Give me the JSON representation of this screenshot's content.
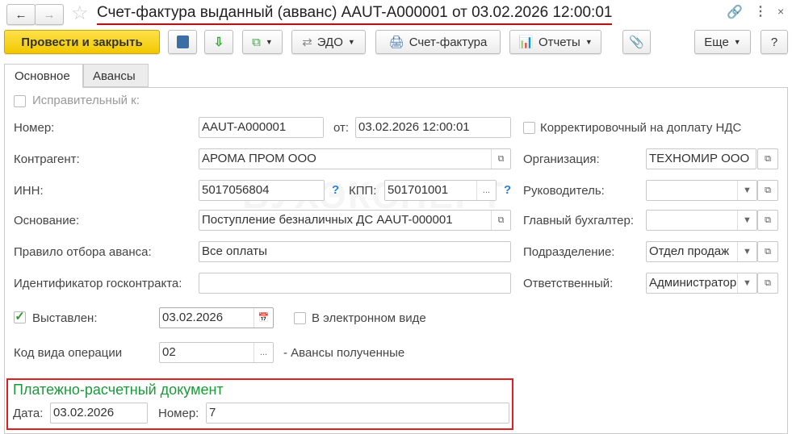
{
  "title": "Счет-фактура выданный (авванс) AAUT-A000001 от 03.02.2026 12:00:01",
  "toolbar": {
    "post_close": "Провести и закрыть",
    "edo": "ЭДО",
    "invoice": "Счет-фактура",
    "reports": "Отчеты",
    "more": "Еще",
    "help": "?"
  },
  "tabs": [
    {
      "label": "Основное"
    },
    {
      "label": "Авансы"
    }
  ],
  "form": {
    "corrective_label": "Исправительный к:",
    "number_label": "Номер:",
    "number": "AAUT-A000001",
    "from_label": "от:",
    "date": "03.02.2026 12:00:01",
    "correction_label": "Корректировочный на доплату НДС",
    "counterparty_label": "Контрагент:",
    "counterparty": "АРОМА ПРОМ ООО",
    "org_label": "Организация:",
    "org": "ТЕХНОМИР ООО",
    "inn_label": "ИНН:",
    "inn": "5017056804",
    "kpp_label": "КПП:",
    "kpp": "501701001",
    "help_mark": "?",
    "head_label": "Руководитель:",
    "head": "",
    "basis_label": "Основание:",
    "basis": "Поступление безналичных ДС AAUT-000001",
    "accountant_label": "Главный бухгалтер:",
    "accountant": "",
    "rule_label": "Правило отбора аванса:",
    "rule": "Все оплаты",
    "division_label": "Подразделение:",
    "division": "Отдел продаж",
    "contract_id_label": "Идентификатор госконтракта:",
    "contract_id": "",
    "responsible_label": "Ответственный:",
    "responsible": "Администратор",
    "issued_label": "Выставлен:",
    "issued_date": "03.02.2026",
    "electronic_label": "В электронном виде",
    "op_code_label": "Код вида операции",
    "op_code": "02",
    "op_code_desc": "- Авансы полученные",
    "payment_doc_title": "Платежно-расчетный документ",
    "pay_date_label": "Дата:",
    "pay_date": "03.02.2026",
    "pay_number_label": "Номер:",
    "pay_number": "7"
  },
  "watermark": "БУХЭКСПЕРТ"
}
